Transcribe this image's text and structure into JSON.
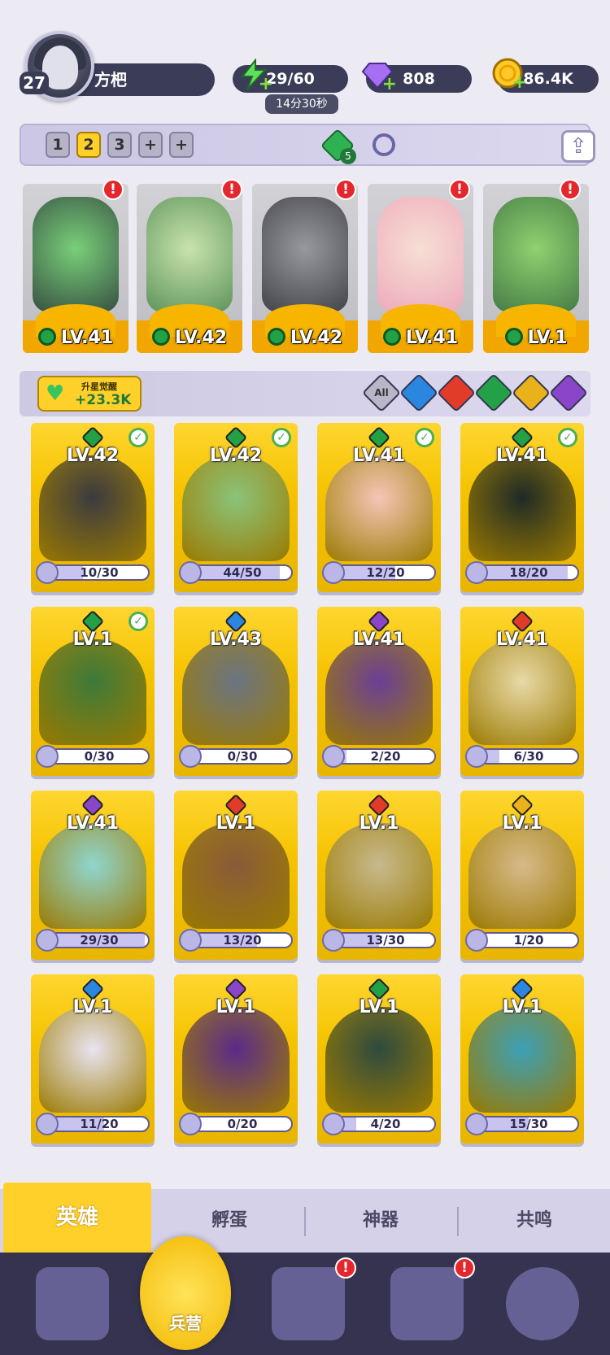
{
  "player": {
    "level": "27",
    "name": "方杷"
  },
  "resources": {
    "energy": "29/60",
    "energy_timer": "14分30秒",
    "gems": "808",
    "gold": "86.4K"
  },
  "team_bar": {
    "slots": [
      "1",
      "2",
      "3",
      "+",
      "+"
    ],
    "active_slot": "2",
    "gem_count": "5"
  },
  "team_heroes": [
    {
      "level": "LV.41",
      "alert": "!"
    },
    {
      "level": "LV.42",
      "alert": "!"
    },
    {
      "level": "LV.42",
      "alert": "!"
    },
    {
      "level": "LV.41",
      "alert": "!"
    },
    {
      "level": "LV.1",
      "alert": "!"
    }
  ],
  "stat": {
    "label": "升星觉醒",
    "value": "+23.3K"
  },
  "filters": [
    "All",
    "water",
    "fire",
    "nature",
    "light",
    "dark"
  ],
  "heroes": [
    {
      "level": "LV.42",
      "progress": "10/30",
      "element": "nature",
      "checked": true,
      "ratio": 0.33
    },
    {
      "level": "LV.42",
      "progress": "44/50",
      "element": "nature",
      "checked": true,
      "ratio": 0.88
    },
    {
      "level": "LV.41",
      "progress": "12/20",
      "element": "nature",
      "checked": true,
      "ratio": 0.6
    },
    {
      "level": "LV.41",
      "progress": "18/20",
      "element": "nature",
      "checked": true,
      "ratio": 0.9
    },
    {
      "level": "LV.1",
      "progress": "0/30",
      "element": "nature",
      "checked": true,
      "ratio": 0
    },
    {
      "level": "LV.43",
      "progress": "0/30",
      "element": "water",
      "checked": false,
      "ratio": 0
    },
    {
      "level": "LV.41",
      "progress": "2/20",
      "element": "dark",
      "checked": false,
      "ratio": 0.1
    },
    {
      "level": "LV.41",
      "progress": "6/30",
      "element": "fire",
      "checked": false,
      "ratio": 0.2
    },
    {
      "level": "LV.41",
      "progress": "29/30",
      "element": "dark",
      "checked": false,
      "ratio": 0.97
    },
    {
      "level": "LV.1",
      "progress": "13/20",
      "element": "fire",
      "checked": false,
      "ratio": 0.65
    },
    {
      "level": "LV.1",
      "progress": "13/30",
      "element": "fire",
      "checked": false,
      "ratio": 0.43
    },
    {
      "level": "LV.1",
      "progress": "1/20",
      "element": "light",
      "checked": false,
      "ratio": 0.05
    },
    {
      "level": "LV.1",
      "progress": "11/20",
      "element": "water",
      "checked": false,
      "ratio": 0.55
    },
    {
      "level": "LV.1",
      "progress": "0/20",
      "element": "dark",
      "checked": false,
      "ratio": 0
    },
    {
      "level": "LV.1",
      "progress": "4/20",
      "element": "nature",
      "checked": false,
      "ratio": 0.2
    },
    {
      "level": "LV.1",
      "progress": "15/30",
      "element": "water",
      "checked": false,
      "ratio": 0.5
    }
  ],
  "tabs": {
    "hero": "英雄",
    "egg": "孵蛋",
    "artifact": "神器",
    "resonance": "共鸣"
  },
  "nav": {
    "barracks": "兵营",
    "alert": "!"
  },
  "colors": {
    "accent": "#ffd02a",
    "nature": "#23a146",
    "water": "#2b86e0",
    "fire": "#e23b2a",
    "light": "#e9b21b",
    "dark": "#8b45c9"
  }
}
